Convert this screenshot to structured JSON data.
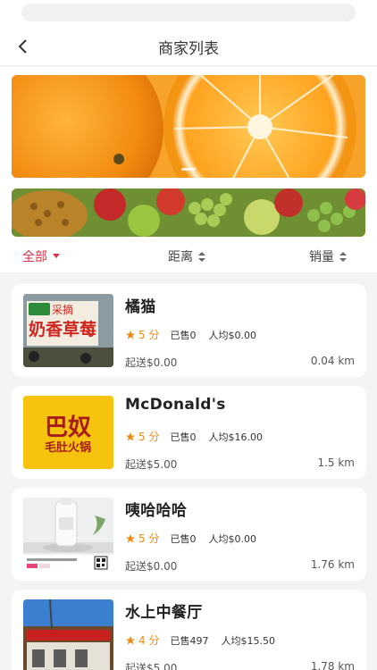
{
  "header": {
    "title": "商家列表"
  },
  "filters": {
    "all": "全部",
    "distance": "距离",
    "sales": "销量"
  },
  "colors": {
    "accent": "#d9334a",
    "star": "#f08a17"
  },
  "stores": [
    {
      "name": "橘猫",
      "rating": "5 分",
      "sold": "已售0",
      "avg": "人均$0.00",
      "min_order": "起送$0.00",
      "distance": "0.04 km",
      "thumb_text": [
        "采摘",
        "奶香草莓"
      ]
    },
    {
      "name": "McDonald's",
      "rating": "5 分",
      "sold": "已售0",
      "avg": "人均$16.00",
      "min_order": "起送$5.00",
      "distance": "1.5 km",
      "thumb_text": [
        "巴奴",
        "毛肚火锅"
      ]
    },
    {
      "name": "咦哈哈哈",
      "rating": "5 分",
      "sold": "已售0",
      "avg": "人均$0.00",
      "min_order": "起送$0.00",
      "distance": "1.76 km",
      "thumb_text": []
    },
    {
      "name": "水上中餐厅",
      "rating": "4 分",
      "sold": "已售497",
      "avg": "人均$15.50",
      "min_order": "起送$5.00",
      "distance": "1.78 km",
      "thumb_text": []
    }
  ]
}
